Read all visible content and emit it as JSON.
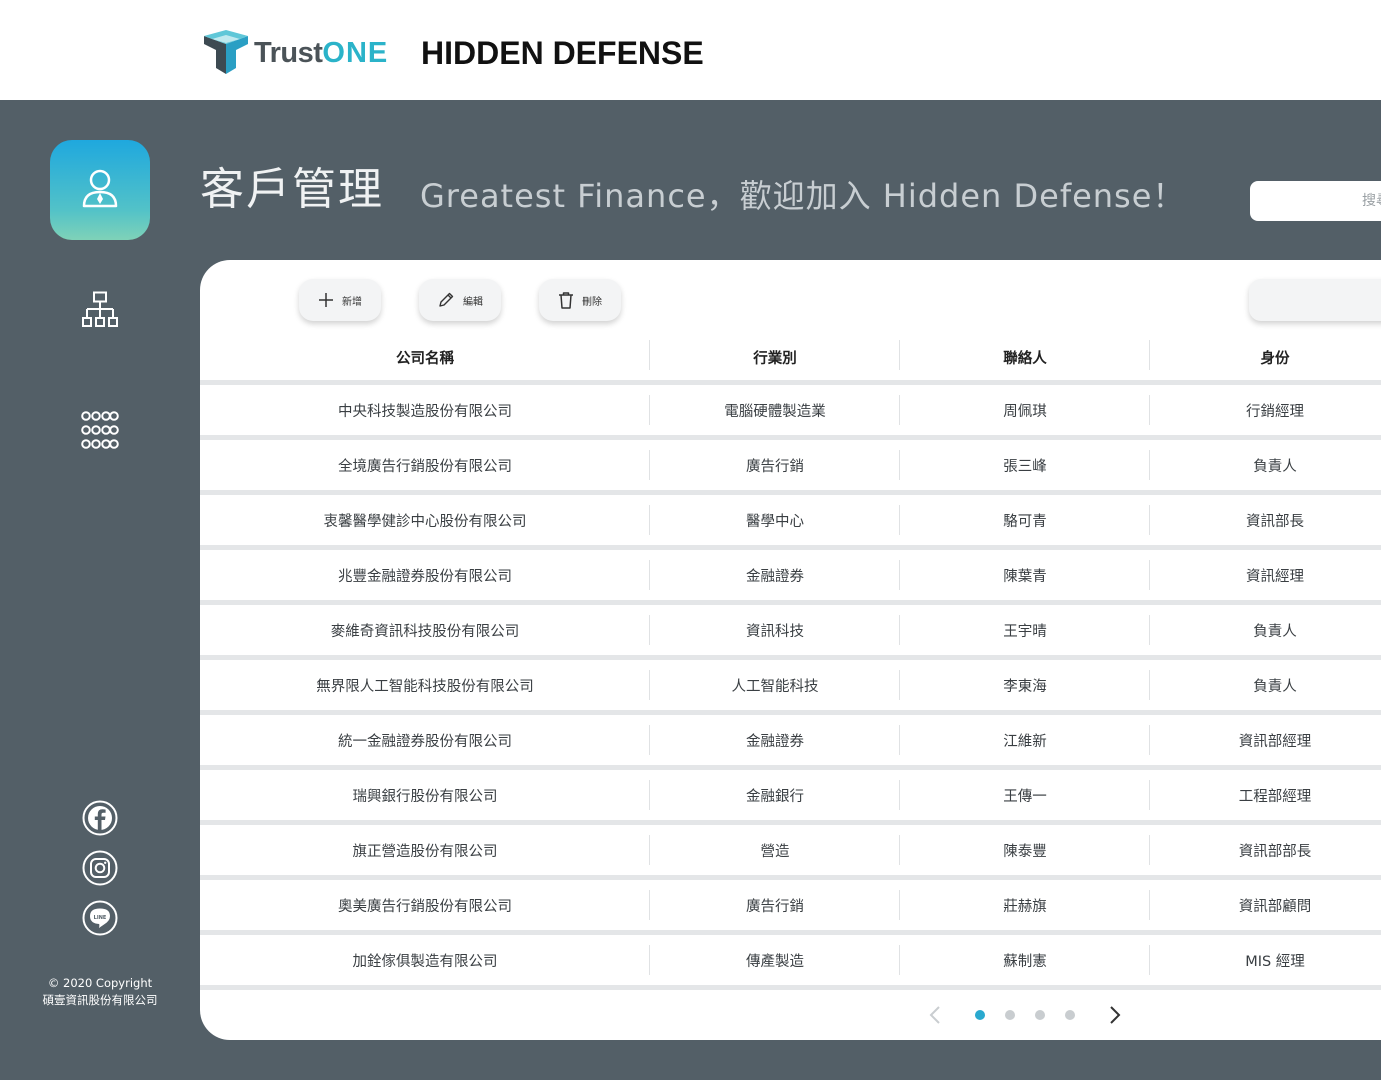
{
  "brand": {
    "name_prefix": "Trust",
    "name_suffix": "ONE",
    "product": "HIDDEN DEFENSE"
  },
  "header": {
    "title": "客戶管理",
    "welcome": "Greatest Finance，歡迎加入 Hidden Defense！",
    "search_placeholder": "搜尋"
  },
  "sidebar": {
    "items": [
      {
        "icon": "user-icon",
        "active": true
      },
      {
        "icon": "org-chart-icon",
        "active": false
      },
      {
        "icon": "apps-grid-icon",
        "active": false
      }
    ],
    "social": [
      "facebook-icon",
      "instagram-icon",
      "line-icon"
    ],
    "copyright_line1": "© 2020 Copyright",
    "copyright_line2": "碩壹資訊股份有限公司"
  },
  "toolbar": {
    "add_label": "新增",
    "edit_label": "編輯",
    "delete_label": "刪除"
  },
  "table": {
    "columns": [
      "公司名稱",
      "行業別",
      "聯絡人",
      "身份"
    ],
    "rows": [
      [
        "中央科技製造股份有限公司",
        "電腦硬體製造業",
        "周佩琪",
        "行銷經理"
      ],
      [
        "全境廣告行銷股份有限公司",
        "廣告行銷",
        "張三峰",
        "負責人"
      ],
      [
        "衷馨醫學健診中心股份有限公司",
        "醫學中心",
        "駱可青",
        "資訊部長"
      ],
      [
        "兆豐金融證券股份有限公司",
        "金融證券",
        "陳葉青",
        "資訊經理"
      ],
      [
        "麥維奇資訊科技股份有限公司",
        "資訊科技",
        "王宇晴",
        "負責人"
      ],
      [
        "無界限人工智能科技股份有限公司",
        "人工智能科技",
        "李東海",
        "負責人"
      ],
      [
        "統一金融證券股份有限公司",
        "金融證券",
        "江維新",
        "資訊部經理"
      ],
      [
        "瑞興銀行股份有限公司",
        "金融銀行",
        "王傳一",
        "工程部經理"
      ],
      [
        "旗正營造股份有限公司",
        "營造",
        "陳泰豐",
        "資訊部部長"
      ],
      [
        "奧美廣告行銷股份有限公司",
        "廣告行銷",
        "莊赫旗",
        "資訊部顧問"
      ],
      [
        "加銓傢俱製造有限公司",
        "傳產製造",
        "蘇制憲",
        "MIS 經理"
      ]
    ]
  },
  "pagination": {
    "pages": 4,
    "current": 1
  },
  "colors": {
    "accent": "#2aa9cf",
    "background": "#535f67"
  }
}
